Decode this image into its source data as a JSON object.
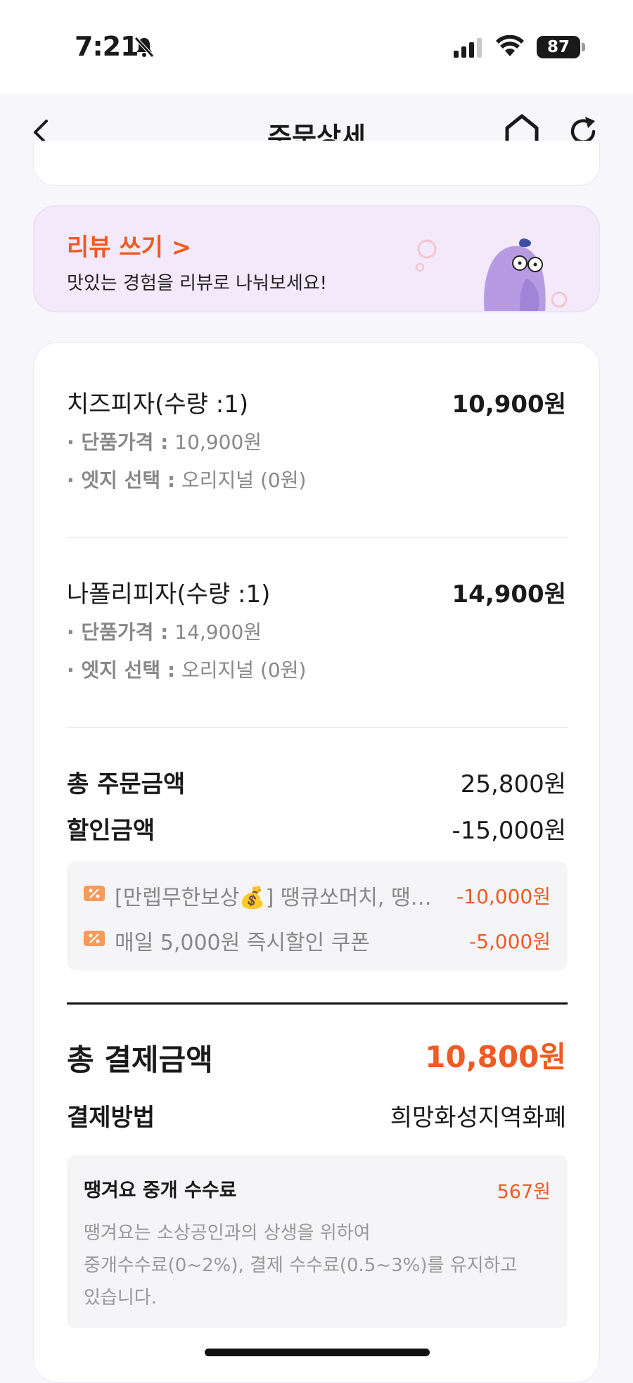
{
  "status_bar": {
    "time": "7:21",
    "battery": "87",
    "icons": [
      "bell-off-icon",
      "signal-icon",
      "wifi-icon",
      "battery-icon"
    ]
  },
  "nav": {
    "title": "주문상세",
    "icons": [
      "back-icon",
      "home-icon",
      "refresh-icon"
    ]
  },
  "review_banner": {
    "title": "리뷰 쓰기 >",
    "subtitle": "맛있는 경험을 리뷰로 나눠보세요!"
  },
  "items": [
    {
      "name": "치즈피자(수량 :1)",
      "price": "10,900원",
      "unit_price_label": "· 단품가격 :",
      "unit_price": "10,900원",
      "edge_label": "· 엣지 선택 :",
      "edge_value": "오리지널 (0원)"
    },
    {
      "name": "나폴리피자(수량 :1)",
      "price": "14,900원",
      "unit_price_label": "· 단품가격 :",
      "unit_price": "14,900원",
      "edge_label": "· 엣지 선택 :",
      "edge_value": "오리지널 (0원)"
    }
  ],
  "summary": {
    "order_total_label": "총 주문금액",
    "order_total": "25,800원",
    "discount_label": "할인금액",
    "discount": "-15,000원"
  },
  "coupons": [
    {
      "name": "[만렙무한보상💰] 땡큐쏘머치, 땡…",
      "amount": "-10,000원"
    },
    {
      "name": "매일 5,000원 즉시할인 쿠폰",
      "amount": "-5,000원"
    }
  ],
  "payment": {
    "total_label": "총 결제금액",
    "total": "10,800원",
    "method_label": "결제방법",
    "method": "희망화성지역화폐"
  },
  "fee": {
    "title": "땡겨요 중개 수수료",
    "amount": "567원",
    "desc_1": "땡겨요는 소상공인과의 상생을 위하여",
    "desc_2": "중개수수료(0~2%), 결제 수수료(0.5~3%)를 유지하고",
    "desc_3": "있습니다."
  },
  "colors": {
    "accent": "#f05a23",
    "banner_bg": "#f4e9fb",
    "page_bg": "#f7f6fb"
  }
}
